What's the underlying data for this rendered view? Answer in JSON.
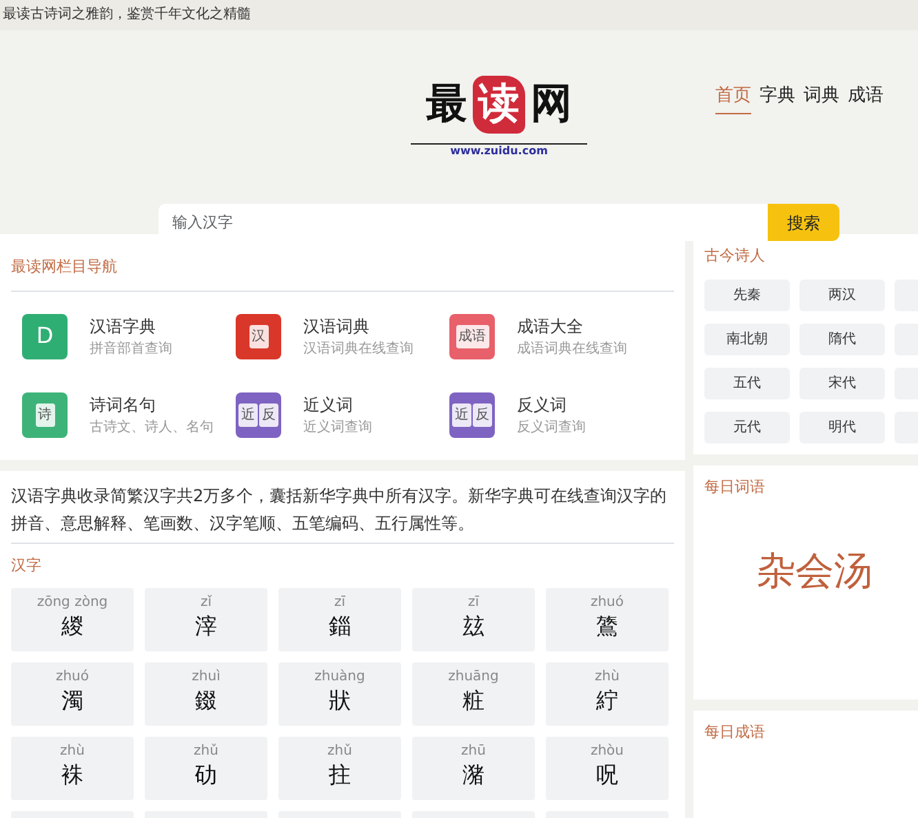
{
  "top_bar": {
    "text": "最读古诗词之雅韵，鉴赏千年文化之精髓"
  },
  "logo": {
    "chars": [
      "最",
      "读",
      "网"
    ],
    "url": "www.zuidu.com"
  },
  "nav": [
    {
      "label": "首页",
      "selected": true
    },
    {
      "label": "字典",
      "selected": false
    },
    {
      "label": "词典",
      "selected": false
    },
    {
      "label": "成语",
      "selected": false
    }
  ],
  "search": {
    "placeholder": "输入汉字",
    "button": "搜索"
  },
  "column_nav": {
    "title": "最读网栏目导航",
    "items": [
      {
        "title": "汉语字典",
        "subtitle": "拼音部首查询",
        "icon_text": [
          "D"
        ],
        "color": "#2fae74"
      },
      {
        "title": "汉语词典",
        "subtitle": "汉语词典在线查询",
        "icon_text": [
          "汉"
        ],
        "color": "#d9372a"
      },
      {
        "title": "成语大全",
        "subtitle": "成语词典在线查询",
        "icon_text": [
          "成语"
        ],
        "color": "#e8606a"
      },
      {
        "title": "诗词名句",
        "subtitle": "古诗文、诗人、名句",
        "icon_text": [
          "诗"
        ],
        "color": "#3db37a"
      },
      {
        "title": "近义词",
        "subtitle": "近义词查询",
        "icon_text": [
          "近",
          "反"
        ],
        "color": "#7e63c2"
      },
      {
        "title": "反义词",
        "subtitle": "反义词查询",
        "icon_text": [
          "近",
          "反"
        ],
        "color": "#7e63c2"
      }
    ]
  },
  "dictionary": {
    "intro": "汉语字典收录简繁汉字共2万多个，囊括新华字典中所有汉字。新华字典可在线查询汉字的拼音、意思解释、笔画数、汉字笔顺、五笔编码、五行属性等。",
    "heading": "汉字",
    "characters": [
      {
        "pinyin": "zōng zòng",
        "char": "緵"
      },
      {
        "pinyin": "zǐ",
        "char": "滓"
      },
      {
        "pinyin": "zī",
        "char": "錙"
      },
      {
        "pinyin": "zī",
        "char": "玆"
      },
      {
        "pinyin": "zhuó",
        "char": "鷟"
      },
      {
        "pinyin": "zhuó",
        "char": "濁"
      },
      {
        "pinyin": "zhuì",
        "char": "錣"
      },
      {
        "pinyin": "zhuàng",
        "char": "狀"
      },
      {
        "pinyin": "zhuāng",
        "char": "粧"
      },
      {
        "pinyin": "zhù",
        "char": "紵"
      },
      {
        "pinyin": "zhù",
        "char": "袾"
      },
      {
        "pinyin": "zhǔ",
        "char": "劯"
      },
      {
        "pinyin": "zhǔ",
        "char": "拄"
      },
      {
        "pinyin": "zhū",
        "char": "潴"
      },
      {
        "pinyin": "zhòu",
        "char": "呪"
      }
    ]
  },
  "poets": {
    "title": "古今诗人",
    "eras": [
      "先秦",
      "两汉",
      "南北朝",
      "隋代",
      "五代",
      "宋代",
      "元代",
      "明代"
    ]
  },
  "daily_word": {
    "title": "每日词语",
    "word": "杂会汤"
  },
  "daily_idiom": {
    "title": "每日成语"
  }
}
